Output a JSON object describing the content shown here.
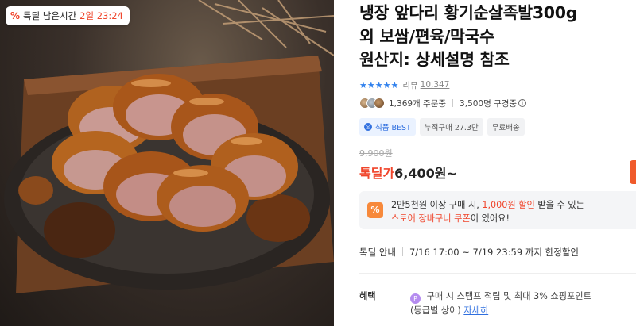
{
  "badge": {
    "label": "특딜 남은시간",
    "time": "2일 23:24",
    "icon": "percent-icon"
  },
  "product": {
    "title_line1": "냉장 앞다리 황기순살족발300g",
    "title_line2": "외 보쌈/편육/막국수",
    "title_line3": "원산지: 상세설명 참조"
  },
  "rating": {
    "stars": "★★★★★",
    "review_label": "리뷰",
    "review_count": "10,347"
  },
  "stats": {
    "orders": "1,369개 주문중",
    "subscribers": "3,500명 구경중",
    "info_icon": "i"
  },
  "tags": {
    "best": "식품 BEST",
    "best_icon": "◎",
    "cumulative": "누적구매 27.3만",
    "shipping": "무료배송"
  },
  "price": {
    "original": "9,900원",
    "deal_label": "톡딜가",
    "deal_price": "6,400원~"
  },
  "coupon": {
    "icon": "%",
    "line1_a": "2만5천원 이상 구매 시, ",
    "line1_hl": "1,000원 할인",
    "line1_b": " 받을 수 있는",
    "line2_hl": "스토어 장바구니 쿠폰",
    "line2_b": "이 있어요!"
  },
  "deal_info": {
    "label": "톡딜 안내",
    "period": "7/16 17:00 ~ 7/19 23:59 까지 한정할인"
  },
  "benefit": {
    "label": "혜택",
    "icon": "P",
    "line1": "구매 시 스탬프 적립 및 최대 3% 쇼핑포인트",
    "line2": "(등급별 상이)",
    "link": "자세히"
  },
  "colors": {
    "accent": "#f0452b",
    "blue": "#2f80ed",
    "coupon_icon": "#f7893b"
  }
}
